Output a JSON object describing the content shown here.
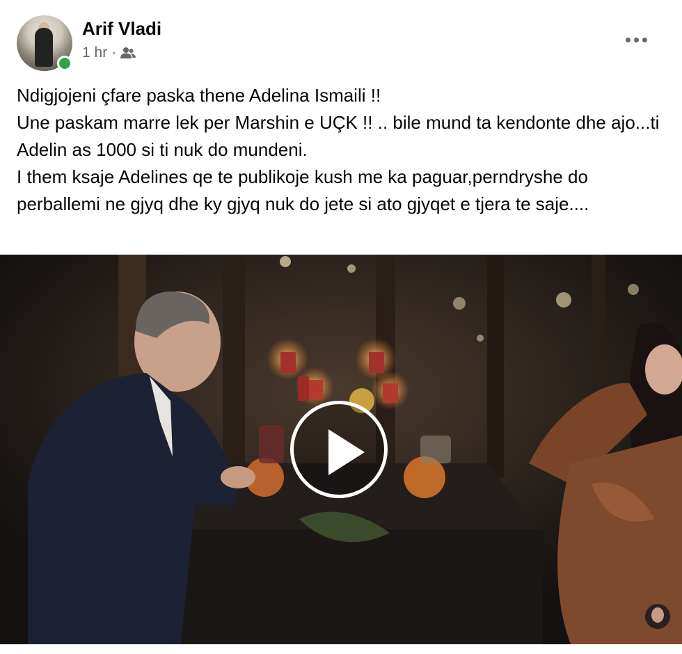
{
  "post": {
    "author": "Arif Vladi",
    "time": "1 hr",
    "separator": "·",
    "audience_icon": "friends-icon",
    "more_icon": "more-options-icon",
    "text": "Ndigjojeni çfare paska thene Adelina Ismaili !!\nUne paskam marre lek per Marshin e UÇK !! .. bile mund ta kendonte dhe ajo...ti Adelin as 1000 si ti nuk do mundeni.\nI them ksaje Adelines qe te publikoje kush me ka paguar,perndryshe do perballemi ne gjyq dhe ky gjyq nuk do jete si ato gjyqet e tjera te saje...."
  },
  "video": {
    "play_icon": "play-icon",
    "online_status_color": "#31a24c"
  }
}
